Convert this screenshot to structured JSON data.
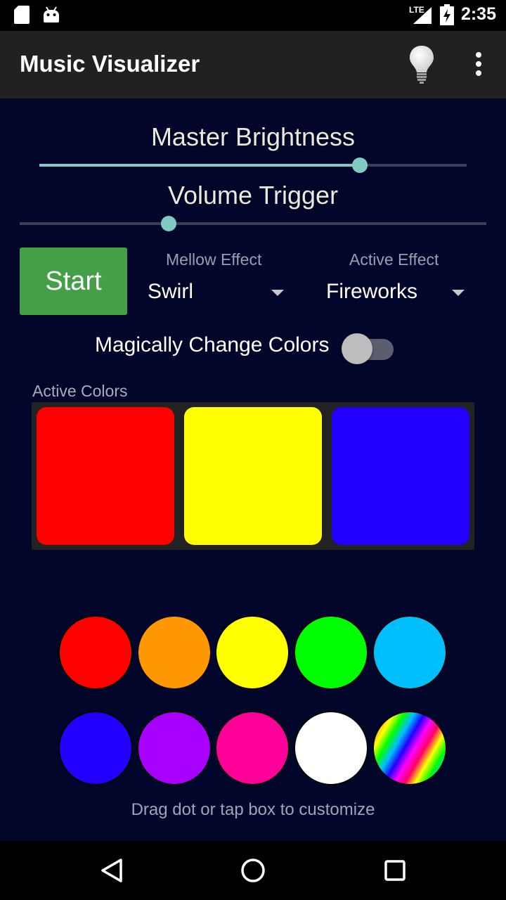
{
  "status_bar": {
    "time": "2:35",
    "network_label": "LTE",
    "icons": [
      "sd-card-icon",
      "android-icon",
      "lte-signal-icon",
      "battery-charging-icon"
    ]
  },
  "toolbar": {
    "title": "Music Visualizer",
    "icons": [
      "lightbulb-icon",
      "more-vert-icon"
    ]
  },
  "master_brightness": {
    "label": "Master Brightness",
    "value_percent": 75
  },
  "volume_trigger": {
    "label": "Volume Trigger",
    "value_percent": 32
  },
  "start_button": {
    "label": "Start",
    "color": "#43a047"
  },
  "mellow_effect": {
    "label": "Mellow Effect",
    "value": "Swirl"
  },
  "active_effect": {
    "label": "Active Effect",
    "value": "Fireworks"
  },
  "magic_colors": {
    "label": "Magically Change Colors",
    "enabled": false
  },
  "active_colors": {
    "label": "Active Colors",
    "swatches": [
      "#ff0000",
      "#ffff00",
      "#2200ff"
    ]
  },
  "palette": {
    "row1": [
      "#ff0000",
      "#ff9800",
      "#ffff00",
      "#00ff00",
      "#00bfff"
    ],
    "row2": [
      "#2200ff",
      "#aa00ff",
      "#ff0099",
      "#ffffff",
      "rainbow"
    ]
  },
  "hint": "Drag dot or tap box to customize",
  "nav_bar": {
    "icons": [
      "back-icon",
      "home-icon",
      "recents-icon"
    ]
  }
}
